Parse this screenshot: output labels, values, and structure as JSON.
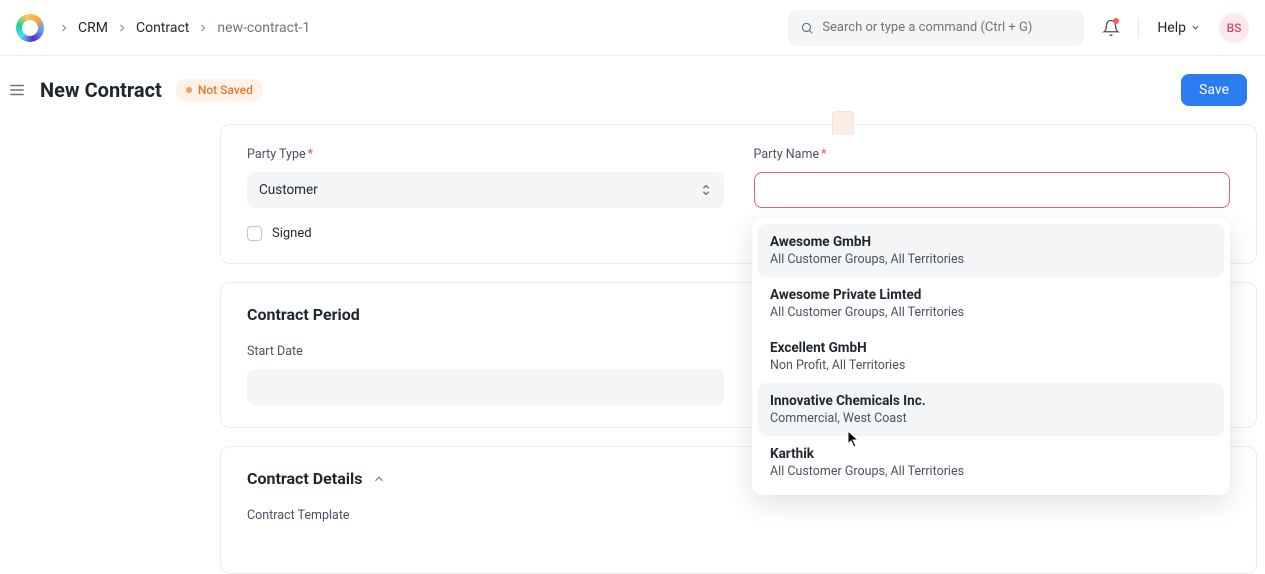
{
  "breadcrumb": {
    "root": "CRM",
    "mid": "Contract",
    "leaf": "new-contract-1"
  },
  "search": {
    "placeholder": "Search or type a command (Ctrl + G)"
  },
  "help": {
    "label": "Help"
  },
  "avatar": {
    "initials": "BS"
  },
  "page": {
    "title": "New Contract"
  },
  "status": {
    "label": "Not Saved"
  },
  "actions": {
    "save": "Save"
  },
  "fields": {
    "party_type": {
      "label": "Party Type",
      "value": "Customer"
    },
    "party_name": {
      "label": "Party Name",
      "value": ""
    },
    "signed": {
      "label": "Signed"
    },
    "start_date": {
      "label": "Start Date"
    },
    "contract_template": {
      "label": "Contract Template"
    }
  },
  "sections": {
    "period": "Contract Period",
    "details": "Contract Details"
  },
  "dropdown": {
    "items": [
      {
        "name": "Awesome GmbH",
        "sub": "All Customer Groups, All Territories",
        "hl": true
      },
      {
        "name": "Awesome Private Limted",
        "sub": "All Customer Groups, All Territories",
        "hl": false
      },
      {
        "name": "Excellent GmbH",
        "sub": "Non Profit, All Territories",
        "hl": false
      },
      {
        "name": "Innovative Chemicals Inc.",
        "sub": "Commercial, West Coast",
        "hl": true
      },
      {
        "name": "Karthik",
        "sub": "All Customer Groups, All Territories",
        "hl": false
      }
    ]
  }
}
